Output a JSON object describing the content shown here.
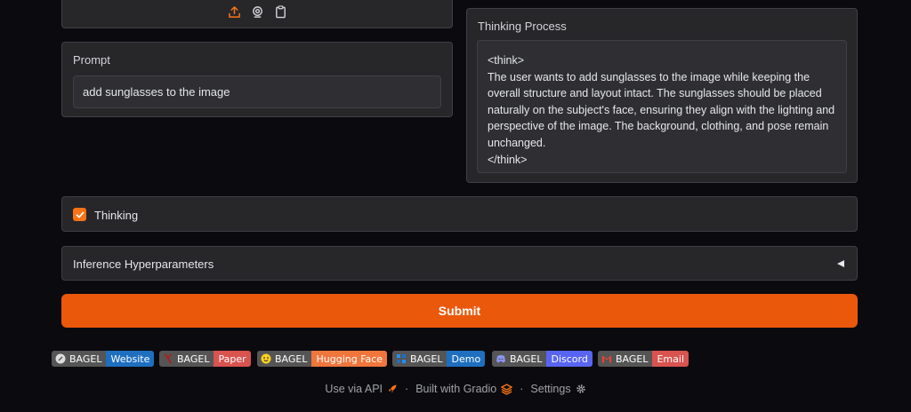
{
  "prompt": {
    "label": "Prompt",
    "value": "add sunglasses to the image"
  },
  "thinking_process": {
    "label": "Thinking Process",
    "text": "<think>\nThe user wants to add sunglasses to the image while keeping the overall structure and layout intact. The sunglasses should be placed naturally on the subject's face, ensuring they align with the lighting and perspective of the image. The background, clothing, and pose remain unchanged.\n</think>"
  },
  "thinking_toggle": {
    "label": "Thinking",
    "checked": true
  },
  "hyperparameters": {
    "label": "Inference Hyperparameters"
  },
  "submit": {
    "label": "Submit"
  },
  "badges": [
    {
      "left": "BAGEL",
      "right": "Website",
      "icon": "link-icon",
      "color": "#1e6fc0"
    },
    {
      "left": "BAGEL",
      "right": "Paper",
      "icon": "arxiv-icon",
      "color": "#d9534f"
    },
    {
      "left": "BAGEL",
      "right": "Hugging Face",
      "icon": "hugging-face-icon",
      "color": "#f0763c"
    },
    {
      "left": "BAGEL",
      "right": "Demo",
      "icon": "demo-icon",
      "color": "#1e6fc0"
    },
    {
      "left": "BAGEL",
      "right": "Discord",
      "icon": "discord-icon",
      "color": "#5865f2"
    },
    {
      "left": "BAGEL",
      "right": "Email",
      "icon": "gmail-icon",
      "color": "#d9534f"
    }
  ],
  "footer": {
    "api": "Use via API",
    "built": "Built with Gradio",
    "settings": "Settings"
  },
  "colors": {
    "accent": "#ea580c",
    "panel": "#27272a",
    "background": "#0b0b0f"
  }
}
